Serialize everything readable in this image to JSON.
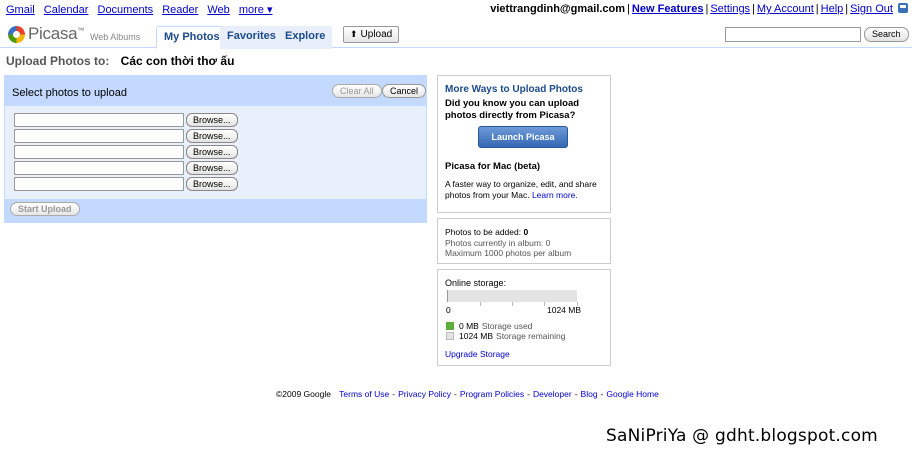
{
  "gbar": {
    "links": [
      "Gmail",
      "Calendar",
      "Documents",
      "Reader",
      "Web",
      "more ▾"
    ],
    "email": "viettrangdinh@gmail.com",
    "right_links": [
      "New Features",
      "Settings",
      "My Account",
      "Help",
      "Sign Out"
    ]
  },
  "header": {
    "logo_text": "Picasa",
    "logo_tm": "™",
    "logo_sub": "Web Albums",
    "tabs": [
      "My Photos",
      "Favorites",
      "Explore"
    ],
    "active_tab": "My Photos",
    "upload_label": "Upload",
    "search_value": "",
    "search_button": "Search"
  },
  "upload": {
    "label": "Upload Photos to:",
    "album": "Các con thời thơ ấu"
  },
  "panel": {
    "title": "Select photos to upload",
    "clear_all": "Clear All",
    "cancel": "Cancel",
    "browse_label": "Browse...",
    "file_rows": [
      "",
      "",
      "",
      "",
      ""
    ],
    "start_upload": "Start Upload"
  },
  "ways": {
    "title": "More Ways to Upload Photos",
    "question": "Did you know you can upload photos directly from Picasa?",
    "launch": "Launch Picasa",
    "mac_title": "Picasa for Mac (beta)",
    "mac_desc": "A faster way to organize, edit, and share photos from your Mac.",
    "learn_more": "Learn more."
  },
  "counts": {
    "to_be_added_label": "Photos to be added:",
    "to_be_added": "0",
    "in_album_label": "Photos currently in album:",
    "in_album": "0",
    "max": "Maximum 1000 photos per album"
  },
  "storage": {
    "title": "Online storage:",
    "used_fraction": 0,
    "min_label": "0",
    "max_label": "1024 MB",
    "used_value": "0 MB",
    "used_text": "Storage used",
    "remaining_value": "1024 MB",
    "remaining_text": "Storage remaining",
    "upgrade": "Upgrade Storage",
    "used_color": "#5fae3b",
    "remaining_color": "#e4e4e4"
  },
  "footer": {
    "copyright": "©2009 Google",
    "links": [
      "Terms of Use",
      "Privacy Policy",
      "Program Policies",
      "Developer",
      "Blog",
      "Google Home"
    ]
  },
  "watermark": "SaNiPriYa @ gdht.blogspot.com"
}
